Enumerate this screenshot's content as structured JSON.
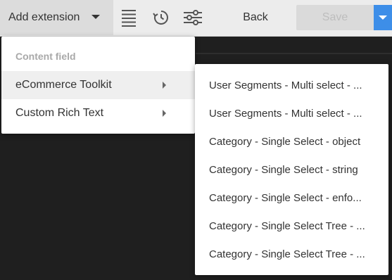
{
  "toolbar": {
    "add_extension_label": "Add extension",
    "icons": [
      "list-view-icon",
      "history-icon",
      "settings-sliders-icon"
    ],
    "back_label": "Back",
    "save_label": "Save"
  },
  "menu": {
    "header": "Content field",
    "items": [
      {
        "label": "eCommerce Toolkit",
        "has_submenu": true,
        "active": true
      },
      {
        "label": "Custom Rich Text",
        "has_submenu": true,
        "active": false
      }
    ]
  },
  "submenu": {
    "items": [
      {
        "label": "User Segments - Multi select - ..."
      },
      {
        "label": "User Segments - Multi select - ..."
      },
      {
        "label": "Category - Single Select - object"
      },
      {
        "label": "Category - Single Select - string"
      },
      {
        "label": "Category - Single Select - enfo..."
      },
      {
        "label": "Category - Single Select Tree - ..."
      },
      {
        "label": "Category - Single Select Tree - ..."
      }
    ]
  },
  "colors": {
    "toolbar_bg": "#ececec",
    "add_extension_bg": "#dcdcdc",
    "save_disabled_bg": "#dadada",
    "save_caret_bg": "#3d8ee8",
    "workspace_bg": "#1f1f1f",
    "menu_active_bg": "#efefef"
  }
}
